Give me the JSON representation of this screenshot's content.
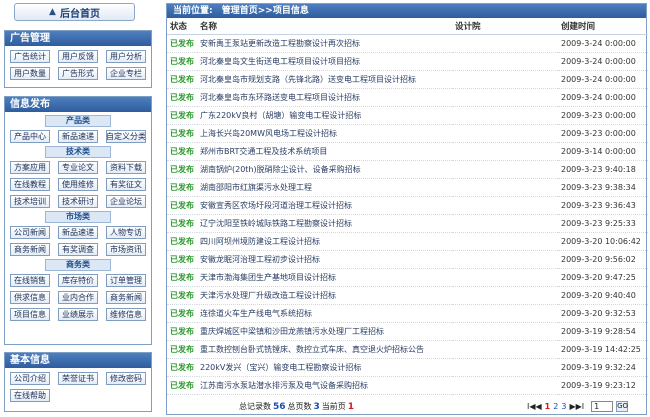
{
  "sidebar": {
    "home_label": "后台首页",
    "ad": {
      "title": "广告管理",
      "rows": [
        [
          "广告统计",
          "用户反馈",
          "用户分析"
        ],
        [
          "用户数量",
          "广告形式",
          "企业专栏"
        ]
      ]
    },
    "info": {
      "title": "信息发布",
      "groups": [
        {
          "cat": "产品类",
          "rows": [
            [
              "产品中心",
              "新品速递",
              "自定义分类"
            ]
          ]
        },
        {
          "cat": "技术类",
          "rows": [
            [
              "方案应用",
              "专业论文",
              "资料下载"
            ],
            [
              "在线教程",
              "使用维修",
              "有奖征文"
            ],
            [
              "技术培训",
              "技术研讨",
              "企业论坛"
            ]
          ]
        },
        {
          "cat": "市场类",
          "rows": [
            [
              "公司新闻",
              "新品速递",
              "人物专访"
            ],
            [
              "商务新闻",
              "有奖调查",
              "市场资讯"
            ]
          ]
        },
        {
          "cat": "商务类",
          "rows": [
            [
              "在线销售",
              "库存特价",
              "订单管理"
            ],
            [
              "供求信息",
              "业内合作",
              "商务新闻"
            ],
            [
              "项目信息",
              "业绩展示",
              "维修信息"
            ]
          ]
        }
      ]
    },
    "basic": {
      "title": "基本信息",
      "rows": [
        [
          "公司介绍",
          "荣誉证书",
          "修改密码"
        ],
        [
          "在线帮助"
        ]
      ]
    }
  },
  "main": {
    "breadcrumb_label": "当前位置:",
    "breadcrumb_path": "管理首页>>项目信息",
    "headers": {
      "status": "状态",
      "name": "名称",
      "design": "设计院",
      "time": "创建时间"
    },
    "rows": [
      {
        "status": "已发布",
        "name": "安新禹王泵站更新改造工程勘察设计再次招标",
        "time": "2009-3-24 0:00:00"
      },
      {
        "status": "已发布",
        "name": "河北秦皇岛文生街送电工程项目设计项目招标",
        "time": "2009-3-24 0:00:00"
      },
      {
        "status": "已发布",
        "name": "河北秦皇岛市规划支路（先锋北路）送变电工程项目设计招标",
        "time": "2009-3-24 0:00:00"
      },
      {
        "status": "已发布",
        "name": "河北秦皇岛市东环路送变电工程项目设计招标",
        "time": "2009-3-24 0:00:00"
      },
      {
        "status": "已发布",
        "name": "广东220kV良村（胡塘）输变电工程设计招标",
        "time": "2009-3-23 0:00:00"
      },
      {
        "status": "已发布",
        "name": "上海长兴岛20MW风电场工程设计招标",
        "time": "2009-3-23 0:00:00"
      },
      {
        "status": "已发布",
        "name": "郑州市BRT交通工程及技术系统项目",
        "time": "2009-3-14 0:00:00"
      },
      {
        "status": "已发布",
        "name": "湖南锅炉(20th)脱硝除尘设计、设备采购招标",
        "time": "2009-3-23 9:40:18"
      },
      {
        "status": "已发布",
        "name": "湖南邵阳市红旗渠污水处理工程",
        "time": "2009-3-23 9:38:34"
      },
      {
        "status": "已发布",
        "name": "安徽宣秀区农场圩段河道治理工程设计招标",
        "time": "2009-3-23 9:36:43"
      },
      {
        "status": "已发布",
        "name": "辽宁沈阳至铁岭城际铁路工程勘察设计招标",
        "time": "2009-3-23 9:25:33"
      },
      {
        "status": "已发布",
        "name": "四川阿坝州境防建设工程设计招标",
        "time": "2009-3-20 10:06:42"
      },
      {
        "status": "已发布",
        "name": "安徽龙眠河治理工程初步设计招标",
        "time": "2009-3-20 9:56:02"
      },
      {
        "status": "已发布",
        "name": "天津市渤海集团生产基地项目设计招标",
        "time": "2009-3-20 9:47:25"
      },
      {
        "status": "已发布",
        "name": "天津污水处理厂升级改造工程设计招标",
        "time": "2009-3-20 9:40:40"
      },
      {
        "status": "已发布",
        "name": "连徐道火车生产线电气系统招标",
        "time": "2009-3-20 9:32:53"
      },
      {
        "status": "已发布",
        "name": "重庆焊城区中梁镇和沙田龙燕镇污水处理厂工程招标",
        "time": "2009-3-19 9:28:54"
      },
      {
        "status": "已发布",
        "name": "重工数控刨台卧式铣镗床、数控立式车床、真空退火炉招标公告",
        "time": "2009-3-19 14:42:25"
      },
      {
        "status": "已发布",
        "name": "220kV发兴（宝兴）输变电工程勘察设计招标",
        "time": "2009-3-19 9:32:24"
      },
      {
        "status": "已发布",
        "name": "江苏南污水泵站潜水排污泵及电气设备采购招标",
        "time": "2009-3-19 9:23:12"
      }
    ],
    "pager": {
      "total_label": "总记录数",
      "total": "56",
      "unit_items": "总页数",
      "pages": "3",
      "current_label": "当前页",
      "current": "1",
      "first": "I◀◀",
      "page_links": [
        "1",
        "2",
        "3"
      ],
      "last": "▶▶I",
      "jump_value": "1",
      "go_label": "GO"
    }
  }
}
